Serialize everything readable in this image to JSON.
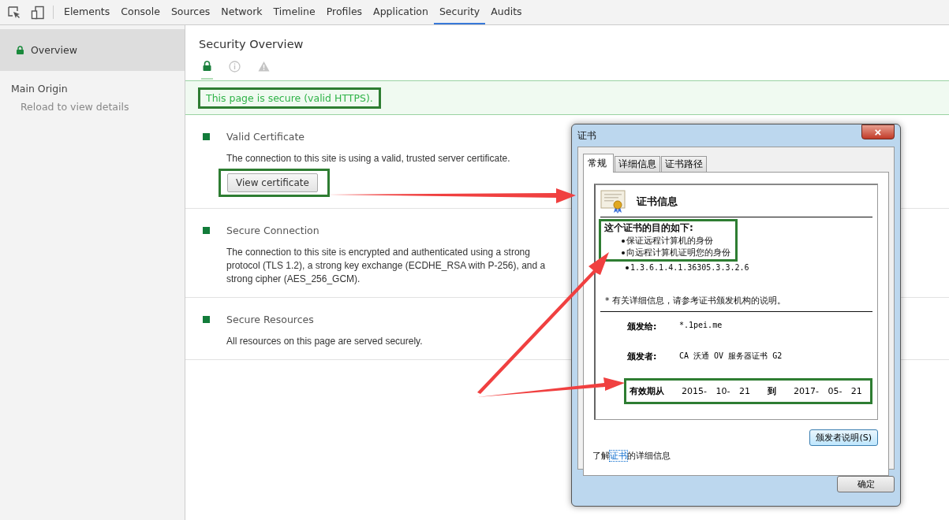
{
  "toolbar": {
    "tabs": [
      {
        "label": "Elements",
        "selected": false
      },
      {
        "label": "Console",
        "selected": false
      },
      {
        "label": "Sources",
        "selected": false
      },
      {
        "label": "Network",
        "selected": false
      },
      {
        "label": "Timeline",
        "selected": false
      },
      {
        "label": "Profiles",
        "selected": false
      },
      {
        "label": "Application",
        "selected": false
      },
      {
        "label": "Security",
        "selected": true
      },
      {
        "label": "Audits",
        "selected": false
      }
    ]
  },
  "sidebar": {
    "items": [
      {
        "kind": "overview",
        "label": "Overview",
        "selected": true
      },
      {
        "kind": "heading",
        "label": "Main Origin"
      },
      {
        "kind": "hint",
        "label": "Reload to view details"
      }
    ]
  },
  "overview": {
    "title": "Security Overview",
    "filters": [
      {
        "kind": "secure",
        "selected": true
      },
      {
        "kind": "info",
        "selected": false
      },
      {
        "kind": "warning",
        "selected": false
      }
    ],
    "banner": {
      "text": "This page is secure (valid HTTPS).",
      "highlighted": true
    },
    "sections": [
      {
        "title": "Valid Certificate",
        "lines": [
          "The connection to this site is using a valid, trusted server certificate."
        ],
        "button": {
          "label": "View certificate",
          "highlighted": true
        }
      },
      {
        "title": "Secure Connection",
        "lines": [
          "The connection to this site is encrypted and authenticated using a strong",
          "protocol (TLS 1.2), a strong key exchange (ECDHE_RSA with P-256), and a",
          "strong cipher (AES_256_GCM)."
        ]
      },
      {
        "title": "Secure Resources",
        "lines": [
          "All resources on this page are served securely."
        ]
      }
    ]
  },
  "dialog": {
    "title": "证书",
    "close": "×",
    "tabs": [
      {
        "label": "常规",
        "selected": true
      },
      {
        "label": "详细信息",
        "selected": false
      },
      {
        "label": "证书路径",
        "selected": false
      }
    ],
    "heading": "证书信息",
    "purposes": {
      "title": "这个证书的目的如下:",
      "highlighted": true,
      "items": [
        "保证远程计算机的身份",
        "向远程计算机证明您的身份"
      ]
    },
    "extra_items": [
      "1.3.6.1.4.1.36305.3.3.2.6"
    ],
    "note": "* 有关详细信息，请参考证书颁发机构的说明。",
    "fields": [
      {
        "label": "颁发给:",
        "value": "*.1pei.me"
      },
      {
        "label": "颁发者:",
        "value": "CA 沃通 OV 服务器证书 G2"
      }
    ],
    "validity": {
      "from_label": "有效期从",
      "from": "2015- 10- 21",
      "to_label": "到",
      "to": "2017- 05- 21",
      "highlighted": true
    },
    "issuer_button": "颁发者说明(S)",
    "learn_more": "了解**证书**的详细信息",
    "ok_button": "确定"
  }
}
